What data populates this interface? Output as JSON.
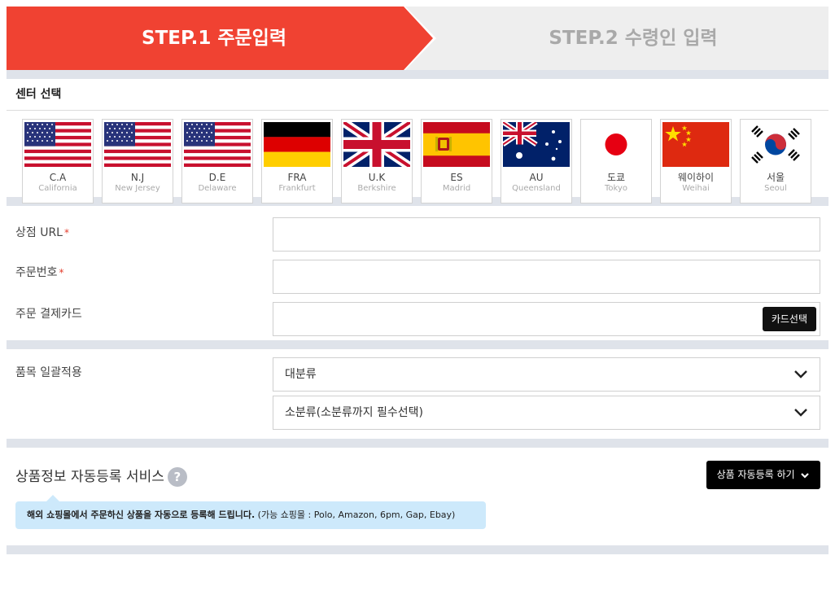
{
  "steps": {
    "step1_label": "STEP.1 주문입력",
    "step2_label": "STEP.2 수령인 입력",
    "active_color": "#f04232"
  },
  "center_select": {
    "title": "센터 선택",
    "centers": [
      {
        "code": "C.A",
        "name": "California",
        "flag": "us-flag-icon"
      },
      {
        "code": "N.J",
        "name": "New Jersey",
        "flag": "us-flag-icon"
      },
      {
        "code": "D.E",
        "name": "Delaware",
        "flag": "us-flag-icon"
      },
      {
        "code": "FRA",
        "name": "Frankfurt",
        "flag": "germany-flag-icon"
      },
      {
        "code": "U.K",
        "name": "Berkshire",
        "flag": "uk-flag-icon"
      },
      {
        "code": "ES",
        "name": "Madrid",
        "flag": "spain-flag-icon"
      },
      {
        "code": "AU",
        "name": "Queensland",
        "flag": "australia-flag-icon"
      },
      {
        "code": "도쿄",
        "name": "Tokyo",
        "flag": "japan-flag-icon"
      },
      {
        "code": "웨이하이",
        "name": "Weihai",
        "flag": "china-flag-icon"
      },
      {
        "code": "서울",
        "name": "Seoul",
        "flag": "korea-flag-icon"
      }
    ]
  },
  "order_form": {
    "store_url_label": "상점 URL",
    "order_number_label": "주문번호",
    "card_label": "주문 결제카드",
    "required_mark": "*",
    "store_url_value": "",
    "order_number_value": "",
    "card_value": "",
    "card_button": "카드선택"
  },
  "category": {
    "label": "품목 일괄적용",
    "major_selected": "대분류",
    "minor_selected": "소분류(소분류까지 필수선택)"
  },
  "auto_register": {
    "title": "상품정보 자동등록 서비스",
    "help_icon": "?",
    "button": "상품 자동등록 하기",
    "notice_bold": "해외 쇼핑몰에서 주문하신 상품을 자동으로 등록해 드립니다.",
    "notice_extra": "(가능 쇼핑몰 : Polo, Amazon, 6pm, Gap, Ebay)"
  }
}
